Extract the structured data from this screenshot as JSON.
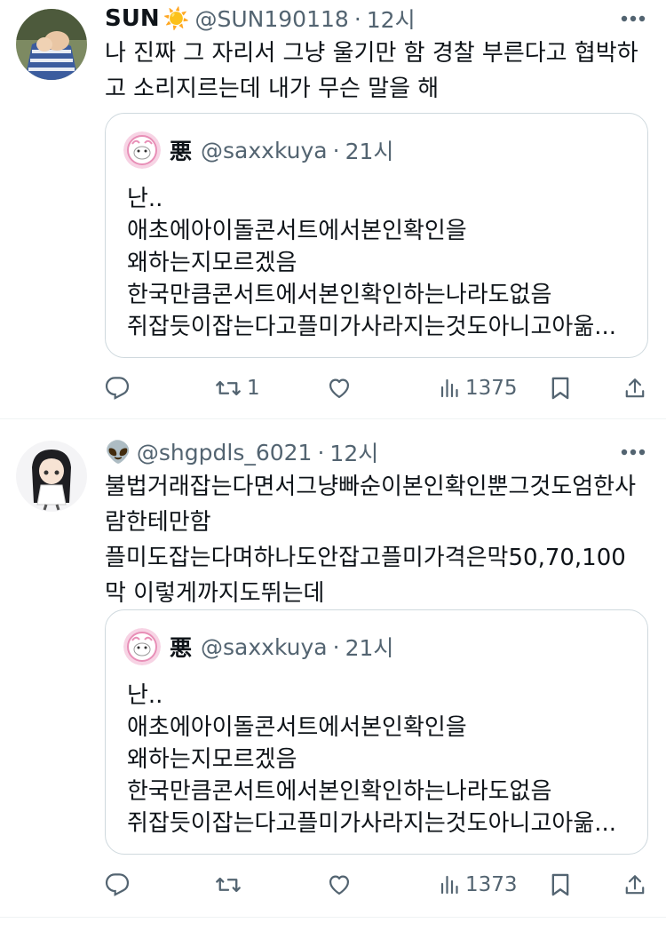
{
  "tweets": [
    {
      "author_name": "SUN",
      "author_emoji": "☀️",
      "handle": "@SUN190118",
      "time": "12시",
      "text_lines": [
        "나 진짜 그 자리서 그냥 울기만 함 경찰 부른다고 협박하",
        "고 소리지르는데 내가 무슨 말을 해"
      ],
      "quote": {
        "name": "悪",
        "handle": "@saxxkuya",
        "time": "21시",
        "lines": [
          "난..",
          "애초에아이돌콘서트에서본인확인을",
          "왜하는지모르겠음",
          "한국만큼콘서트에서본인확인하는나라도없음",
          "쥐잡듯이잡는다고플미가사라지는것도아니고아욺..."
        ]
      },
      "reply_count": "",
      "retweet_count": "1",
      "like_count": "",
      "view_count": "1375"
    },
    {
      "author_name": "",
      "author_emoji": "👽",
      "handle": "@shgpdls_6021",
      "time": "12시",
      "text_lines": [
        "불법거래잡는다면서그냥빠순이본인확인뿐그것도엄한사",
        "람한테만함",
        "플미도잡는다며하나도안잡고플미가격은막50,70,100",
        "막 이렇게까지도뛰는데"
      ],
      "quote": {
        "name": "悪",
        "handle": "@saxxkuya",
        "time": "21시",
        "lines": [
          "난..",
          "애초에아이돌콘서트에서본인확인을",
          "왜하는지모르겠음",
          "한국만큼콘서트에서본인확인하는나라도없음",
          "쥐잡듯이잡는다고플미가사라지는것도아니고아욺..."
        ]
      },
      "reply_count": "",
      "retweet_count": "",
      "like_count": "",
      "view_count": "1373"
    }
  ],
  "separator": "·",
  "colors": {
    "text": "#0f1419",
    "secondary": "#536471",
    "border": "#cfd9de",
    "divider": "#eff3f4"
  }
}
